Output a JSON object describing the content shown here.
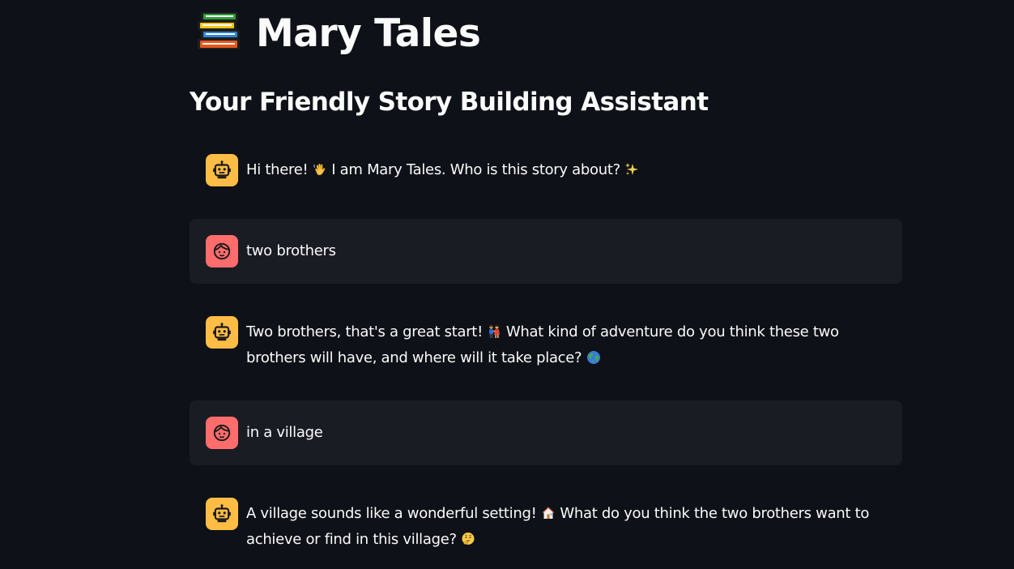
{
  "header": {
    "title": "Mary Tales",
    "subtitle": "Your Friendly Story Building Assistant"
  },
  "messages": [
    {
      "role": "assistant",
      "parts": [
        "Hi there! ",
        " I am Mary Tales. Who is this story about? ",
        ""
      ],
      "emojis": [
        "waving-hand",
        "sparkles"
      ]
    },
    {
      "role": "user",
      "text": "two brothers"
    },
    {
      "role": "assistant",
      "parts": [
        "Two brothers, that's a great start! ",
        " What kind of adventure do you think these two brothers will have, and where will it take place? ",
        ""
      ],
      "emojis": [
        "two-people",
        "globe"
      ]
    },
    {
      "role": "user",
      "text": "in a village"
    },
    {
      "role": "assistant",
      "parts": [
        "A village sounds like a wonderful setting! ",
        " What do you think the two brothers want to achieve or find in this village? ",
        ""
      ],
      "emojis": [
        "house",
        "thinking-face"
      ]
    }
  ],
  "colors": {
    "background": "#0e1117",
    "user_message_bg": "#1a1c24",
    "assistant_avatar": "#ffbd45",
    "user_avatar": "#ff6c6c",
    "text": "#fafafa"
  }
}
